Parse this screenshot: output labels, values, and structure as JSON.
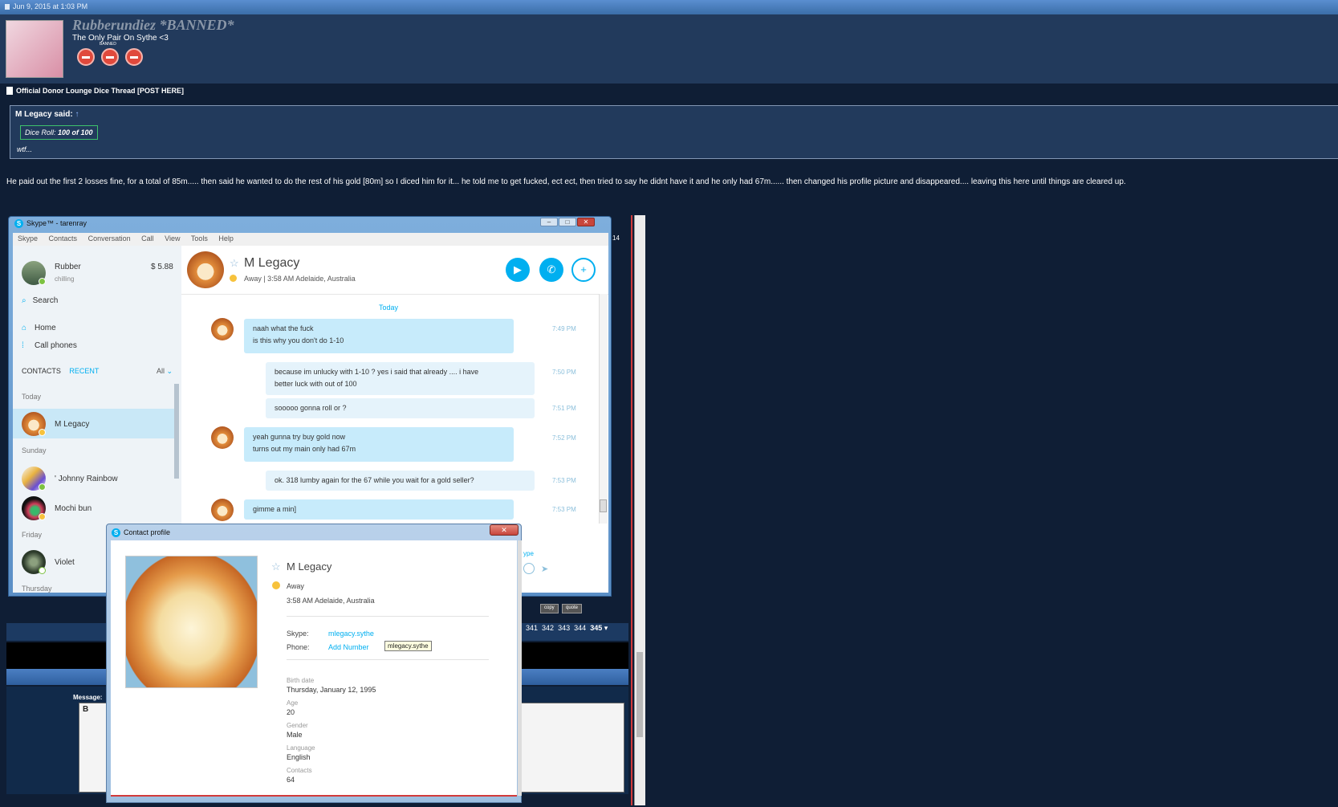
{
  "post": {
    "date": "Jun 9, 2015 at 1:03 PM",
    "username": "Rubberundiez *BANNED*",
    "user_title": "The Only Pair On Sythe <3",
    "banned_label": "BANNED",
    "thread_title": "Official Donor Lounge Dice Thread [POST HERE]",
    "quote_author": "M Legacy said:",
    "quote_arrow": "↑",
    "dice_roll_prefix": "Dice Roll: ",
    "dice_roll_value": "100 of 100",
    "quote_reply": "wtf...",
    "body": "He paid out the first 2 losses fine, for a total of 85m..... then said he wanted to do the rest of his gold [80m] so I diced him for it... he told me to get fucked, ect ect, then tried to say he didnt have it and he only had 67m...... then changed his profile picture and disappeared.... leaving this here until things are cleared up."
  },
  "forum_bits": {
    "message_label": "Message:",
    "side_number": "14",
    "copy": "copy",
    "quote": "quote",
    "pages": [
      "341",
      "342",
      "343",
      "344"
    ],
    "current_page": "345",
    "editor_bold": "B"
  },
  "skype": {
    "window_title": "Skype™ - tarenray",
    "menu": [
      "Skype",
      "Contacts",
      "Conversation",
      "Call",
      "View",
      "Tools",
      "Help"
    ],
    "me": {
      "name": "Rubber",
      "mood": "chilling",
      "credit": "$ 5.88"
    },
    "search_label": "Search",
    "nav": {
      "home": "Home",
      "call_phones": "Call phones"
    },
    "tabs": {
      "contacts": "CONTACTS",
      "recent": "RECENT",
      "filter": "All"
    },
    "groups": {
      "today": "Today",
      "sunday": "Sunday",
      "friday": "Friday",
      "thursday": "Thursday"
    },
    "contacts": {
      "m_legacy": "M Legacy",
      "johnny": "' Johnny Rainbow",
      "mochi": "Mochi bun",
      "violet": "Violet"
    },
    "chat": {
      "name": "M Legacy",
      "status": "Away  |  3:58 AM Adelaide, Australia",
      "day": "Today",
      "messages": [
        {
          "lines": [
            "naah what the fuck",
            "is this why you don't do 1-10"
          ],
          "time": "7:49 PM"
        },
        {
          "lines": [
            "because im unlucky with 1-10 ? yes i said that already .... i have",
            "better luck with out of 100"
          ],
          "time": "7:50 PM"
        },
        {
          "lines": [
            "sooooo gonna roll or ?"
          ],
          "time": "7:51 PM"
        },
        {
          "lines": [
            "yeah gunna try buy gold now",
            "turns out my main only had 67m"
          ],
          "time": "7:52 PM"
        },
        {
          "lines": [
            "ok. 318 lumby again for the 67 while you wait for a gold seller?"
          ],
          "time": "7:53 PM"
        },
        {
          "lines": [
            "gimme a min]"
          ],
          "time": "7:53 PM"
        }
      ],
      "compose_hint": "ype"
    }
  },
  "contact_profile": {
    "title": "Contact profile",
    "name": "M Legacy",
    "status": "Away",
    "local_time": "3:58 AM Adelaide, Australia",
    "skype_label": "Skype:",
    "skype_value": "mlegacy.sythe",
    "phone_label": "Phone:",
    "phone_value": "Add Number",
    "tooltip": "mlegacy.sythe",
    "fields": {
      "birth_label": "Birth date",
      "birth_value": "Thursday, January 12, 1995",
      "age_label": "Age",
      "age_value": "20",
      "gender_label": "Gender",
      "gender_value": "Male",
      "language_label": "Language",
      "language_value": "English",
      "contacts_label": "Contacts",
      "contacts_value": "64"
    }
  },
  "colors": {
    "skype_blue": "#00aff0",
    "forum_bg": "#0f1e35",
    "panel": "#223a5c",
    "banned_red": "#e0493c"
  }
}
